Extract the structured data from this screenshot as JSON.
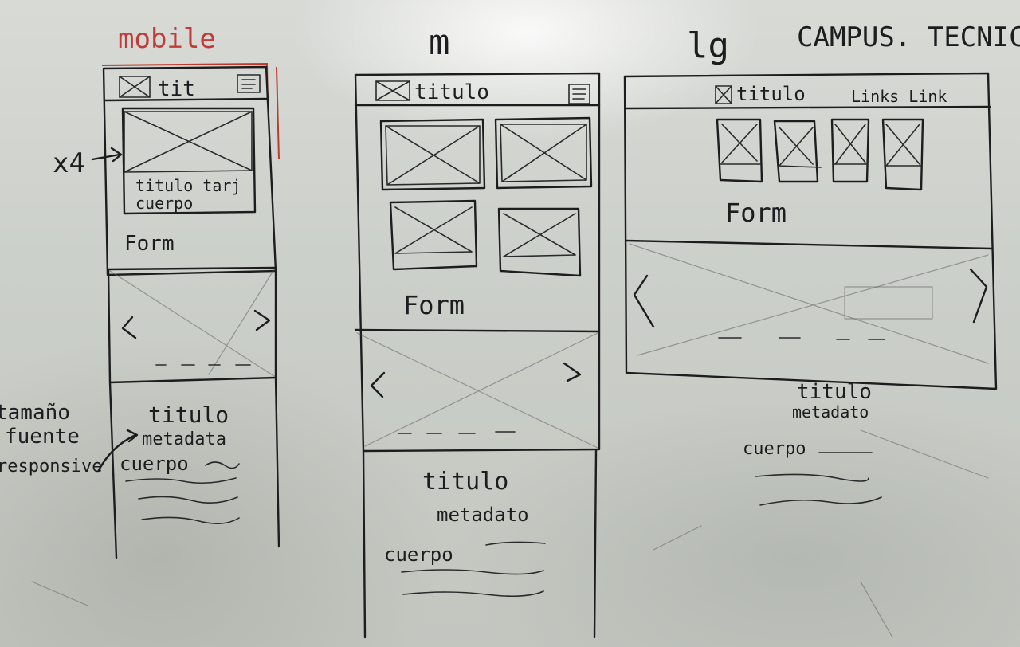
{
  "title_top_right": "CAMPUS. TECNICA",
  "mobile": {
    "heading": "mobile",
    "header_title": "tit",
    "card_multiplier": "x4",
    "card_title": "titulo tarj",
    "card_body": "cuerpo",
    "form_label": "Form",
    "article_title": "titulo",
    "article_meta": "metadata",
    "article_body": "cuerpo",
    "note_font": [
      "tamaño",
      "fuente",
      "responsive"
    ]
  },
  "medium": {
    "heading": "m",
    "header_title": "titulo",
    "form_label": "Form",
    "article_title": "titulo",
    "article_meta": "metadato",
    "article_body": "cuerpo"
  },
  "large": {
    "heading": "lg",
    "header_title": "titulo",
    "header_links": "Links Link",
    "form_label": "Form",
    "article_title": "titulo",
    "article_meta": "metadato",
    "article_body": "cuerpo"
  }
}
